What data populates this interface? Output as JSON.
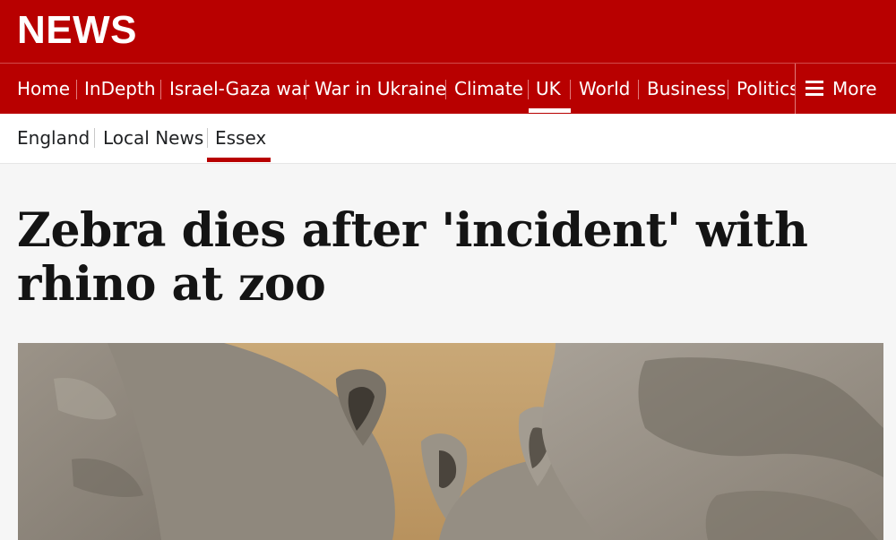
{
  "header": {
    "brand": "NEWS"
  },
  "nav": {
    "items": [
      "Home",
      "InDepth",
      "Israel-Gaza war",
      "War in Ukraine",
      "Climate",
      "UK",
      "World",
      "Business",
      "Politics"
    ],
    "active": "UK",
    "more_label": "More",
    "more_icon": "menu-icon"
  },
  "subnav": {
    "items": [
      "England",
      "Local News",
      "Essex"
    ],
    "active": "Essex"
  },
  "article": {
    "headline": "Zebra dies after 'incident' with rhino at zoo",
    "hero_image": "photo of two rhinos in a dusty zoo enclosure"
  },
  "colors": {
    "brand": "#b80000",
    "text": "#141414",
    "background": "#f6f6f6"
  }
}
